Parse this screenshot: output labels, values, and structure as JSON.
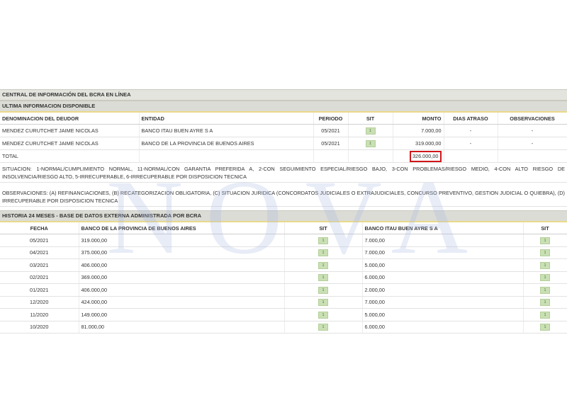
{
  "titles": {
    "central": "CENTRAL DE INFORMACIÓN DEL BCRA EN LÍNEA",
    "ultima": "ULTIMA INFORMACION DISPONIBLE",
    "historia": "HISTORIA 24 MESES - BASE DE DATOS EXTERNA ADMINISTRADA POR BCRA"
  },
  "deudas": {
    "headers": [
      "DENOMINACION DEL DEUDOR",
      "ENTIDAD",
      "PERIODO",
      "SIT",
      "MONTO",
      "DIAS ATRASO",
      "OBSERVACIONES"
    ],
    "rows": [
      {
        "deudor": "MENDEZ CURUTCHET JAIME NICOLAS",
        "entidad": "BANCO ITAU BUEN AYRE S A",
        "periodo": "05/2021",
        "sit": "1",
        "monto": "7.000,00",
        "dias": "-",
        "obs": "-"
      },
      {
        "deudor": "MENDEZ CURUTCHET JAIME NICOLAS",
        "entidad": "BANCO DE LA PROVINCIA DE BUENOS AIRES",
        "periodo": "05/2021",
        "sit": "1",
        "monto": "319.000,00",
        "dias": "-",
        "obs": "-"
      }
    ],
    "total_label": "TOTAL",
    "total_value": "326.000,00"
  },
  "situacion_text": "SITUACION: 1-NORMAL/CUMPLIMIENTO NORMAL, 11-NORMAL/CON GARANTIA PREFERIDA A, 2-CON SEGUIMIENTO ESPECIAL/RIESGO BAJO, 3-CON PROBLEMAS/RIESGO MEDIO, 4-CON ALTO RIESGO DE INSOLVENCIA/RIESGO ALTO, 5-IRRECUPERABLE, 6-IRRECUPERABLE POR DISPOSICION TECNICA",
  "observaciones_text": "OBSERVACIONES: (A) REFINANCIACIONES, (B) RECATEGORIZACION OBLIGATORIA, (C) SITUACION JURIDICA (CONCORDATOS JUDICIALES O EXTRAJUDICIALES, CONCURSO PREVENTIVO, GESTION JUDICIAL O QUIEBRA), (D) IRRECUPERABLE POR DISPOSICION TECNICA",
  "historia": {
    "headers": [
      "FECHA",
      "BANCO DE LA PROVINCIA DE BUENOS AIRES",
      "SIT",
      "BANCO ITAU BUEN AYRE S A",
      "SIT"
    ],
    "rows": [
      {
        "fecha": "05/2021",
        "prov": "319.000,00",
        "sit1": "1",
        "itau": "7.000,00",
        "sit2": "1"
      },
      {
        "fecha": "04/2021",
        "prov": "375.000,00",
        "sit1": "1",
        "itau": "7.000,00",
        "sit2": "1"
      },
      {
        "fecha": "03/2021",
        "prov": "406.000,00",
        "sit1": "1",
        "itau": "5.000,00",
        "sit2": "1"
      },
      {
        "fecha": "02/2021",
        "prov": "369.000,00",
        "sit1": "1",
        "itau": "6.000,00",
        "sit2": "1"
      },
      {
        "fecha": "01/2021",
        "prov": "406.000,00",
        "sit1": "1",
        "itau": "2.000,00",
        "sit2": "1"
      },
      {
        "fecha": "12/2020",
        "prov": "424.000,00",
        "sit1": "1",
        "itau": "7.000,00",
        "sit2": "1"
      },
      {
        "fecha": "11/2020",
        "prov": "149.000,00",
        "sit1": "1",
        "itau": "5.000,00",
        "sit2": "1"
      },
      {
        "fecha": "10/2020",
        "prov": "81.000,00",
        "sit1": "1",
        "itau": "6.000,00",
        "sit2": "1"
      }
    ]
  },
  "watermark": "NOVA",
  "colors": {
    "highlight": "#d0171b",
    "sit_badge": "#c9dfb4",
    "section_bar": "#dcdcd6"
  }
}
